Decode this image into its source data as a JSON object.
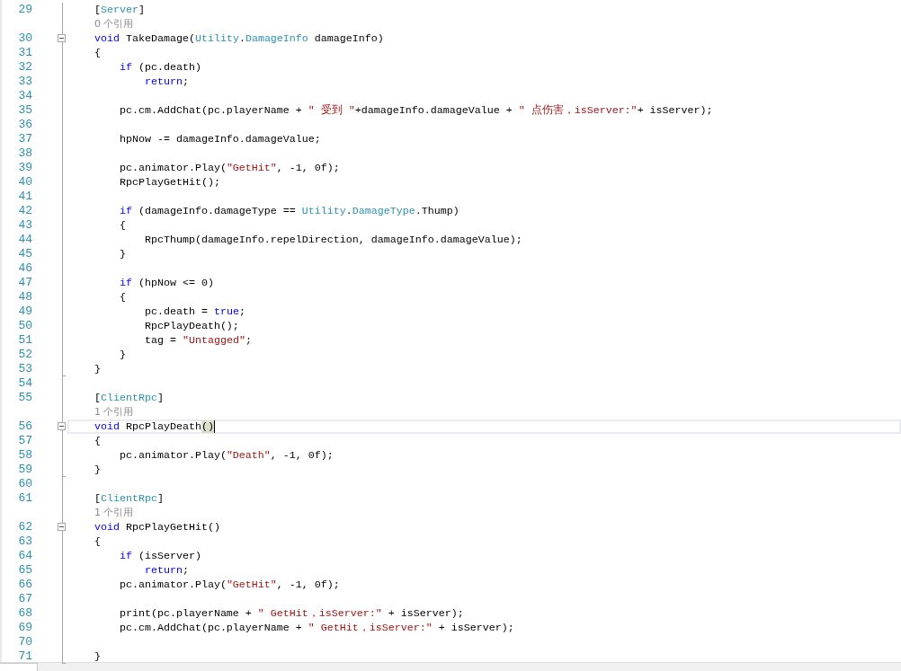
{
  "editor": {
    "rows": [
      {
        "kind": "code",
        "number": "29",
        "current": false,
        "tokens": [
          {
            "kind": "plain",
            "text": "    ["
          },
          {
            "kind": "type",
            "text": "Server"
          },
          {
            "kind": "plain",
            "text": "]"
          }
        ]
      },
      {
        "kind": "codelens",
        "text": "0 个引用"
      },
      {
        "kind": "code",
        "number": "30",
        "current": false,
        "fold": {
          "expanded": true
        },
        "tokens": [
          {
            "kind": "keyword",
            "text": "    void"
          },
          {
            "kind": "plain",
            "text": " TakeDamage("
          },
          {
            "kind": "type",
            "text": "Utility"
          },
          {
            "kind": "plain",
            "text": "."
          },
          {
            "kind": "type",
            "text": "DamageInfo"
          },
          {
            "kind": "plain",
            "text": " damageInfo)"
          }
        ]
      },
      {
        "kind": "code",
        "number": "31",
        "current": false,
        "tokens": [
          {
            "kind": "plain",
            "text": "    {"
          }
        ]
      },
      {
        "kind": "code",
        "number": "32",
        "current": false,
        "tokens": [
          {
            "kind": "keyword",
            "text": "        if"
          },
          {
            "kind": "plain",
            "text": " (pc.death)"
          }
        ]
      },
      {
        "kind": "code",
        "number": "33",
        "current": false,
        "tokens": [
          {
            "kind": "keyword",
            "text": "            return"
          },
          {
            "kind": "plain",
            "text": ";"
          }
        ]
      },
      {
        "kind": "code",
        "number": "34",
        "current": false
      },
      {
        "kind": "code",
        "number": "35",
        "current": false,
        "tokens": [
          {
            "kind": "plain",
            "text": "        pc.cm.AddChat(pc.playerName + "
          },
          {
            "kind": "string",
            "text": "\" 受到 \""
          },
          {
            "kind": "plain",
            "text": "+damageInfo.damageValue + "
          },
          {
            "kind": "string",
            "text": "\" 点伤害，isServer:\""
          },
          {
            "kind": "plain",
            "text": "+ isServer);"
          }
        ]
      },
      {
        "kind": "code",
        "number": "36",
        "current": false
      },
      {
        "kind": "code",
        "number": "37",
        "current": false,
        "tokens": [
          {
            "kind": "plain",
            "text": "        hpNow -= damageInfo.damageValue;"
          }
        ]
      },
      {
        "kind": "code",
        "number": "38",
        "current": false
      },
      {
        "kind": "code",
        "number": "39",
        "current": false,
        "tokens": [
          {
            "kind": "plain",
            "text": "        pc.animator.Play("
          },
          {
            "kind": "string",
            "text": "\"GetHit\""
          },
          {
            "kind": "plain",
            "text": ", -1, 0f);"
          }
        ]
      },
      {
        "kind": "code",
        "number": "40",
        "current": false,
        "tokens": [
          {
            "kind": "plain",
            "text": "        RpcPlayGetHit();"
          }
        ]
      },
      {
        "kind": "code",
        "number": "41",
        "current": false
      },
      {
        "kind": "code",
        "number": "42",
        "current": false,
        "tokens": [
          {
            "kind": "keyword",
            "text": "        if"
          },
          {
            "kind": "plain",
            "text": " (damageInfo.damageType == "
          },
          {
            "kind": "type",
            "text": "Utility"
          },
          {
            "kind": "plain",
            "text": "."
          },
          {
            "kind": "type",
            "text": "DamageType"
          },
          {
            "kind": "plain",
            "text": ".Thump)"
          }
        ]
      },
      {
        "kind": "code",
        "number": "43",
        "current": false,
        "tokens": [
          {
            "kind": "plain",
            "text": "        {"
          }
        ]
      },
      {
        "kind": "code",
        "number": "44",
        "current": false,
        "tokens": [
          {
            "kind": "plain",
            "text": "            RpcThump(damageInfo.repelDirection, damageInfo.damageValue);"
          }
        ]
      },
      {
        "kind": "code",
        "number": "45",
        "current": false,
        "tokens": [
          {
            "kind": "plain",
            "text": "        }"
          }
        ]
      },
      {
        "kind": "code",
        "number": "46",
        "current": false
      },
      {
        "kind": "code",
        "number": "47",
        "current": false,
        "tokens": [
          {
            "kind": "keyword",
            "text": "        if"
          },
          {
            "kind": "plain",
            "text": " (hpNow <= 0)"
          }
        ]
      },
      {
        "kind": "code",
        "number": "48",
        "current": false,
        "tokens": [
          {
            "kind": "plain",
            "text": "        {"
          }
        ]
      },
      {
        "kind": "code",
        "number": "49",
        "current": false,
        "tokens": [
          {
            "kind": "plain",
            "text": "            pc.death = "
          },
          {
            "kind": "keyword",
            "text": "true"
          },
          {
            "kind": "plain",
            "text": ";"
          }
        ]
      },
      {
        "kind": "code",
        "number": "50",
        "current": false,
        "tokens": [
          {
            "kind": "plain",
            "text": "            RpcPlayDeath();"
          }
        ]
      },
      {
        "kind": "code",
        "number": "51",
        "current": false,
        "tokens": [
          {
            "kind": "plain",
            "text": "            tag = "
          },
          {
            "kind": "string",
            "text": "\"Untagged\""
          },
          {
            "kind": "plain",
            "text": ";"
          }
        ]
      },
      {
        "kind": "code",
        "number": "52",
        "current": false,
        "tokens": [
          {
            "kind": "plain",
            "text": "        }"
          }
        ]
      },
      {
        "kind": "code",
        "number": "53",
        "current": false,
        "fold_end": true,
        "tokens": [
          {
            "kind": "plain",
            "text": "    }"
          }
        ]
      },
      {
        "kind": "code",
        "number": "54",
        "current": false
      },
      {
        "kind": "code",
        "number": "55",
        "current": false,
        "tokens": [
          {
            "kind": "plain",
            "text": "    ["
          },
          {
            "kind": "type",
            "text": "ClientRpc"
          },
          {
            "kind": "plain",
            "text": "]"
          }
        ]
      },
      {
        "kind": "codelens",
        "text": "1 个引用"
      },
      {
        "kind": "code",
        "number": "56",
        "current": true,
        "fold": {
          "expanded": true
        },
        "tokens": [
          {
            "kind": "keyword",
            "text": "    void"
          },
          {
            "kind": "plain",
            "text": " RpcPlayDeath"
          },
          {
            "kind": "brace_match",
            "text": "()"
          }
        ]
      },
      {
        "kind": "code",
        "number": "57",
        "current": false,
        "tokens": [
          {
            "kind": "plain",
            "text": "    {"
          }
        ]
      },
      {
        "kind": "code",
        "number": "58",
        "current": false,
        "tokens": [
          {
            "kind": "plain",
            "text": "        pc.animator.Play("
          },
          {
            "kind": "string",
            "text": "\"Death\""
          },
          {
            "kind": "plain",
            "text": ", -1, 0f);"
          }
        ]
      },
      {
        "kind": "code",
        "number": "59",
        "current": false,
        "fold_end": true,
        "tokens": [
          {
            "kind": "plain",
            "text": "    }"
          }
        ]
      },
      {
        "kind": "code",
        "number": "60",
        "current": false
      },
      {
        "kind": "code",
        "number": "61",
        "current": false,
        "tokens": [
          {
            "kind": "plain",
            "text": "    ["
          },
          {
            "kind": "type",
            "text": "ClientRpc"
          },
          {
            "kind": "plain",
            "text": "]"
          }
        ]
      },
      {
        "kind": "codelens",
        "text": "1 个引用"
      },
      {
        "kind": "code",
        "number": "62",
        "current": false,
        "fold": {
          "expanded": true
        },
        "tokens": [
          {
            "kind": "keyword",
            "text": "    void"
          },
          {
            "kind": "plain",
            "text": " RpcPlayGetHit()"
          }
        ]
      },
      {
        "kind": "code",
        "number": "63",
        "current": false,
        "tokens": [
          {
            "kind": "plain",
            "text": "    {"
          }
        ]
      },
      {
        "kind": "code",
        "number": "64",
        "current": false,
        "tokens": [
          {
            "kind": "keyword",
            "text": "        if"
          },
          {
            "kind": "plain",
            "text": " (isServer)"
          }
        ]
      },
      {
        "kind": "code",
        "number": "65",
        "current": false,
        "tokens": [
          {
            "kind": "keyword",
            "text": "            return"
          },
          {
            "kind": "plain",
            "text": ";"
          }
        ]
      },
      {
        "kind": "code",
        "number": "66",
        "current": false,
        "tokens": [
          {
            "kind": "plain",
            "text": "        pc.animator.Play("
          },
          {
            "kind": "string",
            "text": "\"GetHit\""
          },
          {
            "kind": "plain",
            "text": ", -1, 0f);"
          }
        ]
      },
      {
        "kind": "code",
        "number": "67",
        "current": false
      },
      {
        "kind": "code",
        "number": "68",
        "current": false,
        "tokens": [
          {
            "kind": "plain",
            "text": "        print(pc.playerName + "
          },
          {
            "kind": "string",
            "text": "\" GetHit，isServer:\""
          },
          {
            "kind": "plain",
            "text": " + isServer);"
          }
        ]
      },
      {
        "kind": "code",
        "number": "69",
        "current": false,
        "tokens": [
          {
            "kind": "plain",
            "text": "        pc.cm.AddChat(pc.playerName + "
          },
          {
            "kind": "string",
            "text": "\" GetHit，isServer:\""
          },
          {
            "kind": "plain",
            "text": " + isServer);"
          }
        ]
      },
      {
        "kind": "code",
        "number": "70",
        "current": false
      },
      {
        "kind": "code",
        "number": "71",
        "current": false,
        "fold_end": true,
        "tokens": [
          {
            "kind": "plain",
            "text": "    }"
          }
        ]
      }
    ]
  }
}
